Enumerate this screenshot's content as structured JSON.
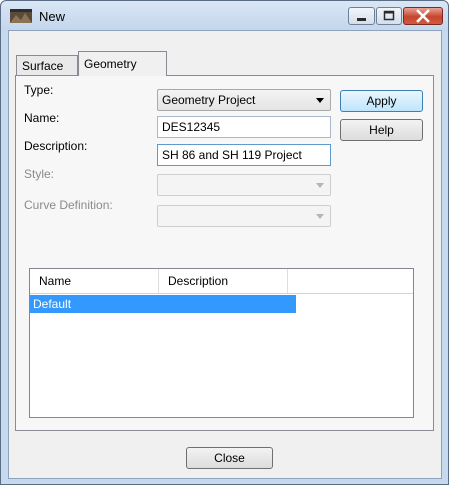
{
  "window": {
    "title": "New",
    "icon": "app-window-icon"
  },
  "tabs": [
    {
      "label": "Surface",
      "selected": false
    },
    {
      "label": "Geometry",
      "selected": true
    }
  ],
  "form": {
    "type_label": "Type:",
    "type_value": "Geometry Project",
    "name_label": "Name:",
    "name_value": "DES12345",
    "description_label": "Description:",
    "description_value": "SH 86 and SH 119 Project",
    "style_label": "Style:",
    "style_value": "",
    "curve_definition_label": "Curve Definition:",
    "curve_definition_value": ""
  },
  "buttons": {
    "apply": "Apply",
    "help": "Help",
    "close": "Close"
  },
  "list": {
    "columns": [
      "Name",
      "Description"
    ],
    "rows": [
      {
        "name": "Default",
        "description": "",
        "selected": true
      }
    ]
  },
  "colors": {
    "selection": "#3399ff",
    "close_button": "#c6452f",
    "title_bar": "#c3d6ec"
  }
}
